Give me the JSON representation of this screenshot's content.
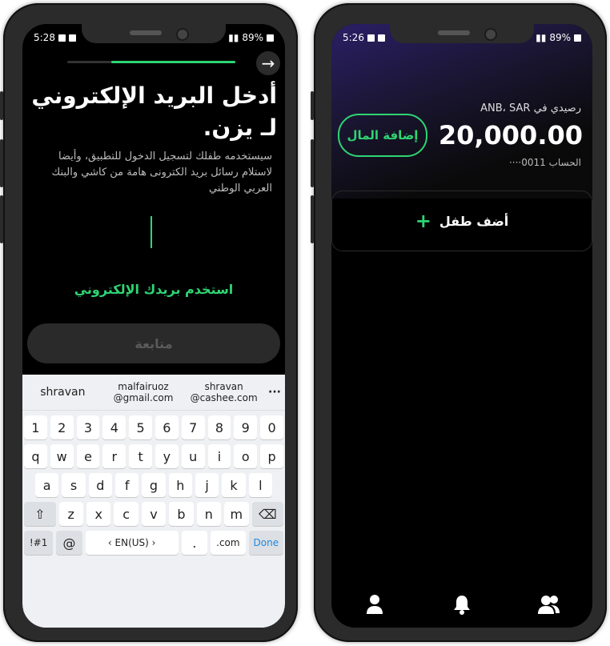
{
  "left": {
    "status": {
      "time": "5:28",
      "battery": "89%"
    },
    "progress_fraction": 0.74,
    "title": "أدخل البريد الإلكتروني لـ يزن.",
    "subtitle": "سيستخدمه طفلك لتسجيل الدخول للتطبيق، وأيضا لاستلام رسائل بريد الكترونى هامة من كاشي والبنك العربي الوطني",
    "use_email_link": "استخدم بريدك الإلكتروني",
    "continue_label": "متابعة",
    "keyboard": {
      "suggestions": [
        {
          "line1": "shravan",
          "line2": ""
        },
        {
          "line1": "malfairuoz",
          "line2": "@gmail.com"
        },
        {
          "line1": "shravan",
          "line2": "@cashee.com"
        }
      ],
      "more": "···",
      "row_numbers": [
        "1",
        "2",
        "3",
        "4",
        "5",
        "6",
        "7",
        "8",
        "9",
        "0"
      ],
      "row_1": [
        "q",
        "w",
        "e",
        "r",
        "t",
        "y",
        "u",
        "i",
        "o",
        "p"
      ],
      "row_2": [
        "a",
        "s",
        "d",
        "f",
        "g",
        "h",
        "j",
        "k",
        "l"
      ],
      "row_3": [
        "z",
        "x",
        "c",
        "v",
        "b",
        "n",
        "m"
      ],
      "symbols": "!#1",
      "at": "@",
      "lang": "‹  EN(US)  ›",
      "period": ".",
      "dotcom": ".com",
      "done": "Done"
    }
  },
  "right": {
    "status": {
      "time": "5:26",
      "battery": "89%"
    },
    "balance_label": "رصيدي في ANB، SAR",
    "balance_amount": "20,000.00",
    "account": "الحساب 0011····",
    "add_money": "إضافة المال",
    "add_child": "أضف طفل",
    "add_child_plus": "+"
  },
  "colors": {
    "accent": "#2ed573",
    "background": "#000000",
    "phone_frame": "#2b2b2b"
  }
}
